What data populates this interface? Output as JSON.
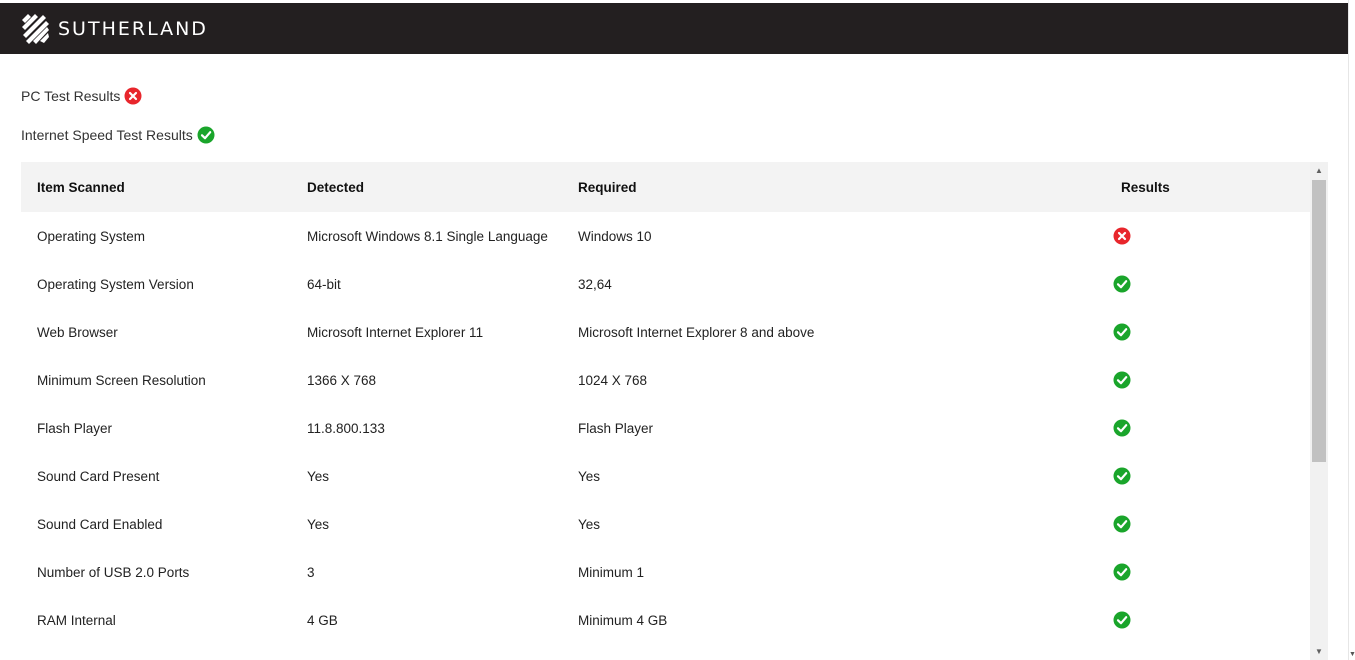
{
  "brand": {
    "name": "SUTHERLAND"
  },
  "summary": [
    {
      "label": "PC Test Results",
      "status": "fail"
    },
    {
      "label": "Internet Speed Test Results",
      "status": "pass"
    }
  ],
  "table": {
    "headers": [
      "Item Scanned",
      "Detected",
      "Required",
      "Results"
    ],
    "rows": [
      {
        "item": "Operating System",
        "detected": "Microsoft Windows 8.1 Single Language",
        "required": "Windows 10",
        "result": "fail"
      },
      {
        "item": "Operating System Version",
        "detected": "64-bit",
        "required": "32,64",
        "result": "pass"
      },
      {
        "item": "Web Browser",
        "detected": "Microsoft Internet Explorer 11",
        "required": "Microsoft Internet Explorer 8 and above",
        "result": "pass"
      },
      {
        "item": "Minimum Screen Resolution",
        "detected": "1366 X 768",
        "required": "1024 X 768",
        "result": "pass"
      },
      {
        "item": "Flash Player",
        "detected": "11.8.800.133",
        "required": "Flash Player",
        "result": "pass"
      },
      {
        "item": "Sound Card Present",
        "detected": "Yes",
        "required": "Yes",
        "result": "pass"
      },
      {
        "item": "Sound Card Enabled",
        "detected": "Yes",
        "required": "Yes",
        "result": "pass"
      },
      {
        "item": "Number of USB 2.0 Ports",
        "detected": "3",
        "required": "Minimum 1",
        "result": "pass"
      },
      {
        "item": "RAM Internal",
        "detected": "4 GB",
        "required": "Minimum 4 GB",
        "result": "pass"
      }
    ]
  },
  "icons": {
    "pass": "check-circle-icon",
    "fail": "x-circle-icon"
  },
  "colors": {
    "header_bg": "#231f20",
    "pass": "#1aa52b",
    "fail": "#e8262c",
    "table_header_bg": "#f3f3f3"
  }
}
